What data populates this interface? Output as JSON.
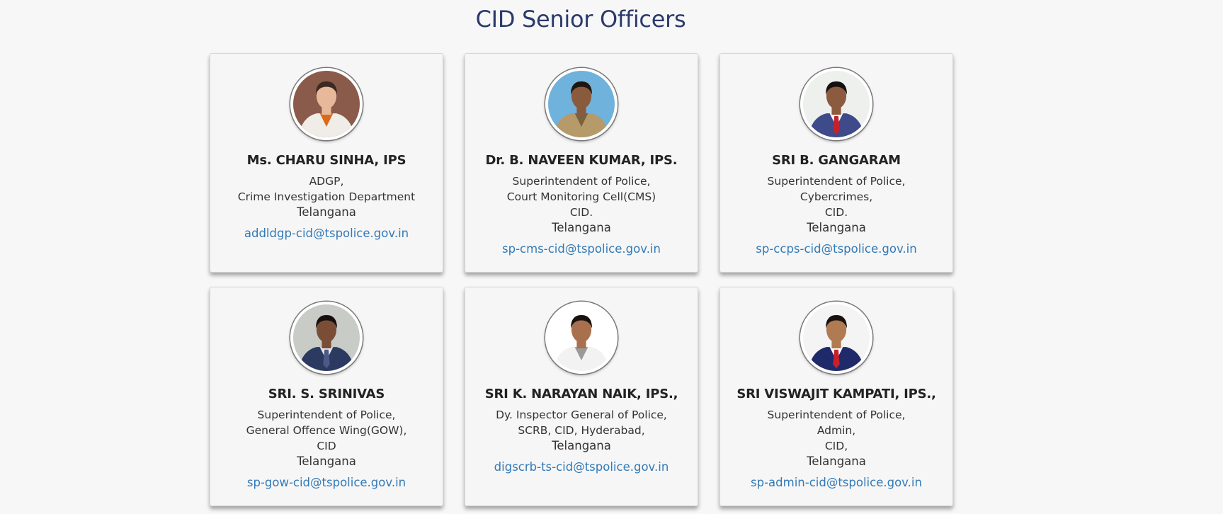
{
  "page": {
    "title": "CID Senior Officers"
  },
  "officers": [
    {
      "name": "Ms. CHARU SINHA, IPS",
      "lines": [
        "ADGP,",
        "Crime Investigation Department",
        "Telangana"
      ],
      "email": "addldgp-cid@tspolice.gov.in",
      "photo": {
        "bg": "#8a5a4a",
        "skin": "#e8b89a",
        "hair": "#3a2a22",
        "body": "#f0ece8",
        "accent": "#d86a1a",
        "tie": ""
      }
    },
    {
      "name": "Dr. B. NAVEEN KUMAR, IPS.",
      "lines": [
        "Superintendent of Police,",
        "Court Monitoring Cell(CMS)",
        "CID.",
        "Telangana"
      ],
      "email": "sp-cms-cid@tspolice.gov.in",
      "photo": {
        "bg": "#6fb2dc",
        "skin": "#8a5a3c",
        "hair": "#1e1510",
        "body": "#b79a6a",
        "accent": "#7a6240",
        "tie": ""
      }
    },
    {
      "name": "SRI B. GANGARAM",
      "lines": [
        "Superintendent of Police,",
        "Cybercrimes,",
        "CID.",
        "Telangana"
      ],
      "email": "sp-ccps-cid@tspolice.gov.in",
      "photo": {
        "bg": "#eef0ee",
        "skin": "#8c5a3e",
        "hair": "#151010",
        "body": "#3e4a8a",
        "accent": "#ffffff",
        "tie": "#c8202a"
      }
    },
    {
      "name": "SRI. S. SRINIVAS",
      "lines": [
        "Superintendent of Police,",
        "General Offence Wing(GOW),",
        "CID",
        "Telangana"
      ],
      "email": "sp-gow-cid@tspolice.gov.in",
      "photo": {
        "bg": "#c8cbc6",
        "skin": "#7a4e36",
        "hair": "#141010",
        "body": "#2c3a62",
        "accent": "#e8e8e8",
        "tie": "#4b5a86"
      }
    },
    {
      "name": "SRI K. NARAYAN NAIK, IPS.,",
      "lines": [
        "Dy. Inspector General of Police,",
        "SCRB, CID, Hyderabad,",
        "Telangana"
      ],
      "email": "digscrb-ts-cid@tspolice.gov.in",
      "photo": {
        "bg": "#ffffff",
        "skin": "#a8704c",
        "hair": "#1a1210",
        "body": "#f2f2f2",
        "accent": "#9a9a9a",
        "tie": ""
      }
    },
    {
      "name": "SRI VISWAJIT KAMPATI, IPS.,",
      "lines": [
        "Superintendent of Police,",
        "Admin,",
        "CID,",
        "Telangana"
      ],
      "email": "sp-admin-cid@tspolice.gov.in",
      "photo": {
        "bg": "#f4f4f4",
        "skin": "#b07a52",
        "hair": "#1a1210",
        "body": "#1e2a6a",
        "accent": "#ffffff",
        "tie": "#c8202a"
      }
    }
  ]
}
